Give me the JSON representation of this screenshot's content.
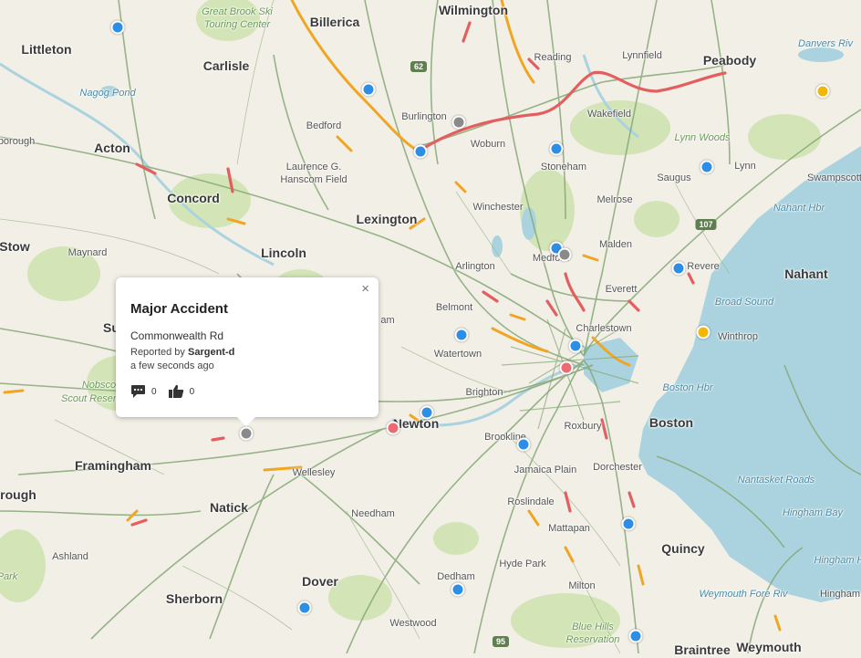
{
  "popup": {
    "title": "Major Accident",
    "road": "Commonwealth Rd",
    "reported_prefix": "Reported by",
    "reporter": "Sargent-d",
    "time": "a few seconds ago",
    "comments_count": "0",
    "thumbs_count": "0",
    "close_label": "×",
    "comment_icon": "comment-icon",
    "thumbs_icon": "thumbs-up-icon"
  },
  "colors": {
    "land": "#f2efe6",
    "water": "#aad3df",
    "park": "#cfe3b0",
    "road": "#86a877",
    "traffic_heavy": "#e35f5f",
    "traffic_moderate": "#f0a623",
    "marker_blue": "#2d8ee6",
    "marker_gray": "#8a8a8a",
    "marker_yellow": "#f2b705",
    "marker_red": "#ee6a73"
  },
  "places": [
    {
      "name": "Billerica",
      "cls": "big"
    },
    {
      "name": "Wilmington",
      "cls": "big"
    },
    {
      "name": "Littleton",
      "cls": "big"
    },
    {
      "name": "Carlisle",
      "cls": "big"
    },
    {
      "name": "Reading",
      "cls": "small"
    },
    {
      "name": "Lynnfield",
      "cls": "small"
    },
    {
      "name": "Peabody",
      "cls": "big"
    },
    {
      "name": "Danvers Riv",
      "cls": "water"
    },
    {
      "name": "Nagog Pond",
      "cls": "water"
    },
    {
      "name": "Burlington",
      "cls": "small"
    },
    {
      "name": "Wakefield",
      "cls": "small"
    },
    {
      "name": "Bedford",
      "cls": "small"
    },
    {
      "name": "Woburn",
      "cls": "small"
    },
    {
      "name": "Lynn Woods",
      "cls": "park"
    },
    {
      "name": "borough",
      "cls": "small"
    },
    {
      "name": "Acton",
      "cls": "big"
    },
    {
      "name": "Stoneham",
      "cls": "small"
    },
    {
      "name": "Saugus",
      "cls": "small"
    },
    {
      "name": "Lynn",
      "cls": "small"
    },
    {
      "name": "Swampscott",
      "cls": "small"
    },
    {
      "name": "Concord",
      "cls": "big"
    },
    {
      "name": "Melrose",
      "cls": "small"
    },
    {
      "name": "Nahant Hbr",
      "cls": "water"
    },
    {
      "name": "Winchester",
      "cls": "small"
    },
    {
      "name": "Lexington",
      "cls": "big"
    },
    {
      "name": "Stow",
      "cls": "big"
    },
    {
      "name": "Maynard",
      "cls": "small"
    },
    {
      "name": "Lincoln",
      "cls": "big"
    },
    {
      "name": "Malden",
      "cls": "small"
    },
    {
      "name": "Medford",
      "cls": "small"
    },
    {
      "name": "Revere",
      "cls": "small"
    },
    {
      "name": "Nahant",
      "cls": "big"
    },
    {
      "name": "Arlington",
      "cls": "small"
    },
    {
      "name": "Everett",
      "cls": "small"
    },
    {
      "name": "Broad Sound",
      "cls": "water"
    },
    {
      "name": "Belmont",
      "cls": "small"
    },
    {
      "name": "Charlestown",
      "cls": "small"
    },
    {
      "name": "Winthrop",
      "cls": "small"
    },
    {
      "name": "Watertown",
      "cls": "small"
    },
    {
      "name": "Brighton",
      "cls": "small"
    },
    {
      "name": "Boston Hbr",
      "cls": "water"
    },
    {
      "name": "Boston",
      "cls": "big"
    },
    {
      "name": "Newton",
      "cls": "big"
    },
    {
      "name": "Roxbury",
      "cls": "small"
    },
    {
      "name": "Brookline",
      "cls": "small"
    },
    {
      "name": "Framingham",
      "cls": "big"
    },
    {
      "name": "Wellesley",
      "cls": "small"
    },
    {
      "name": "Jamaica Plain",
      "cls": "small"
    },
    {
      "name": "Dorchester",
      "cls": "small"
    },
    {
      "name": "Nantasket Roads",
      "cls": "water"
    },
    {
      "name": "Natick",
      "cls": "big"
    },
    {
      "name": "Needham",
      "cls": "small"
    },
    {
      "name": "Roslindale",
      "cls": "small"
    },
    {
      "name": "Hingham Bay",
      "cls": "water"
    },
    {
      "name": "Mattapan",
      "cls": "small"
    },
    {
      "name": "Quincy",
      "cls": "big"
    },
    {
      "name": "Ashland",
      "cls": "small"
    },
    {
      "name": "Hyde Park",
      "cls": "small"
    },
    {
      "name": "Dover",
      "cls": "big"
    },
    {
      "name": "Dedham",
      "cls": "small"
    },
    {
      "name": "Milton",
      "cls": "small"
    },
    {
      "name": "Sherborn",
      "cls": "big"
    },
    {
      "name": "Weymouth Fore Riv",
      "cls": "water"
    },
    {
      "name": "Hingham",
      "cls": "small"
    },
    {
      "name": "Westwood",
      "cls": "small"
    },
    {
      "name": "Braintree",
      "cls": "big"
    },
    {
      "name": "Weymouth",
      "cls": "big"
    },
    {
      "name": "rough",
      "cls": "big"
    },
    {
      "name": "Nobscot",
      "cls": "park"
    },
    {
      "name": "Scout Reserv",
      "cls": "park"
    },
    {
      "name": "Su",
      "cls": "big"
    },
    {
      "name": "am",
      "cls": "small"
    },
    {
      "name": "Hingham H",
      "cls": "water"
    },
    {
      "name": "Park",
      "cls": "park"
    },
    {
      "name": "Blue Hills Reservation",
      "cls": "park"
    },
    {
      "name": "Laurence G. Hanscom Field",
      "cls": "small"
    },
    {
      "name": "Great Brook Ski Touring Center",
      "cls": "park"
    }
  ],
  "shields": [
    {
      "label": "62",
      "color": "#5f7f50"
    },
    {
      "label": "107",
      "color": "#5f7f50"
    },
    {
      "label": "95",
      "color": "#5f7f50"
    }
  ],
  "markers": [
    {
      "color": "blue"
    },
    {
      "color": "blue"
    },
    {
      "color": "blue"
    },
    {
      "color": "gray"
    },
    {
      "color": "blue"
    },
    {
      "color": "yellow"
    },
    {
      "color": "blue"
    },
    {
      "color": "blue"
    },
    {
      "color": "gray"
    },
    {
      "color": "blue"
    },
    {
      "color": "blue"
    },
    {
      "color": "yellow"
    },
    {
      "color": "blue"
    },
    {
      "color": "red"
    },
    {
      "color": "red"
    },
    {
      "color": "blue"
    },
    {
      "color": "gray"
    },
    {
      "color": "blue"
    },
    {
      "color": "blue"
    },
    {
      "color": "blue"
    },
    {
      "color": "blue"
    },
    {
      "color": "blue"
    }
  ]
}
